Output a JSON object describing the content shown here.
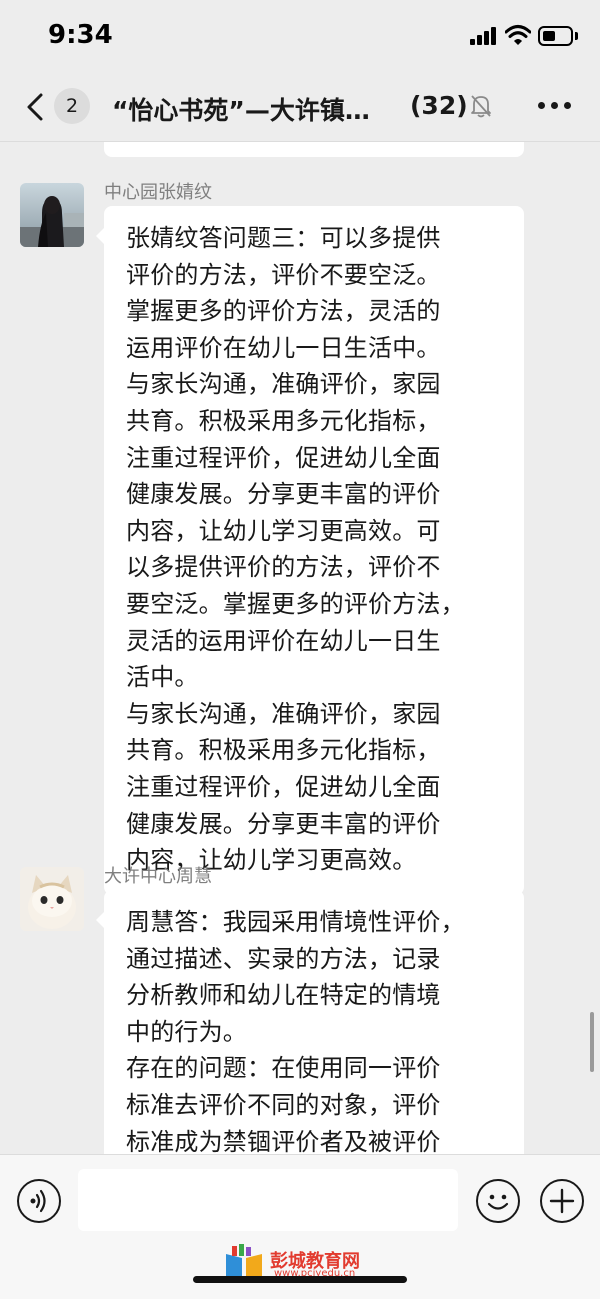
{
  "status_bar": {
    "time": "9:34"
  },
  "nav": {
    "unread_count": "2",
    "title": "“怡心书苑”—大许镇…",
    "member_count": "(32)",
    "icons": [
      "back-icon",
      "mute-icon",
      "more-icon"
    ]
  },
  "messages": [
    {
      "sender": "中心园张婧纹",
      "text": "张婧纹答问题三：可以多提供\n评价的方法，评价不要空泛。\n掌握更多的评价方法，灵活的\n运用评价在幼儿一日生活中。\n与家长沟通，准确评价，家园\n共育。积极采用多元化指标，\n注重过程评价，促进幼儿全面\n健康发展。分享更丰富的评价\n内容，让幼儿学习更高效。可\n以多提供评价的方法，评价不\n要空泛。掌握更多的评价方法，\n灵活的运用评价在幼儿一日生\n活中。\n与家长沟通，准确评价，家园\n共育。积极采用多元化指标，\n注重过程评价，促进幼儿全面\n健康发展。分享更丰富的评价\n内容，让幼儿学习更高效。"
    },
    {
      "sender": "大许中心周慧",
      "text": "周慧答：我园采用情境性评价，\n通过描述、实录的方法，记录\n分析教师和幼儿在特定的情境\n中的行为。\n存在的问题：在使用同一评价\n标准去评价不同的对象，评价\n标准成为禁锢评价者及被评价\n者行为的教条。"
    }
  ],
  "input_bar": {
    "placeholder": "",
    "icons": [
      "voice-icon",
      "emoji-icon",
      "plus-icon"
    ]
  },
  "watermark": {
    "text": "彭城教育网",
    "sub": "www.pcjyedu.cn"
  },
  "colors": {
    "background": "#ededed",
    "bubble": "#ffffff",
    "name": "#7f7f7f",
    "watermark": "#e23b2f"
  }
}
